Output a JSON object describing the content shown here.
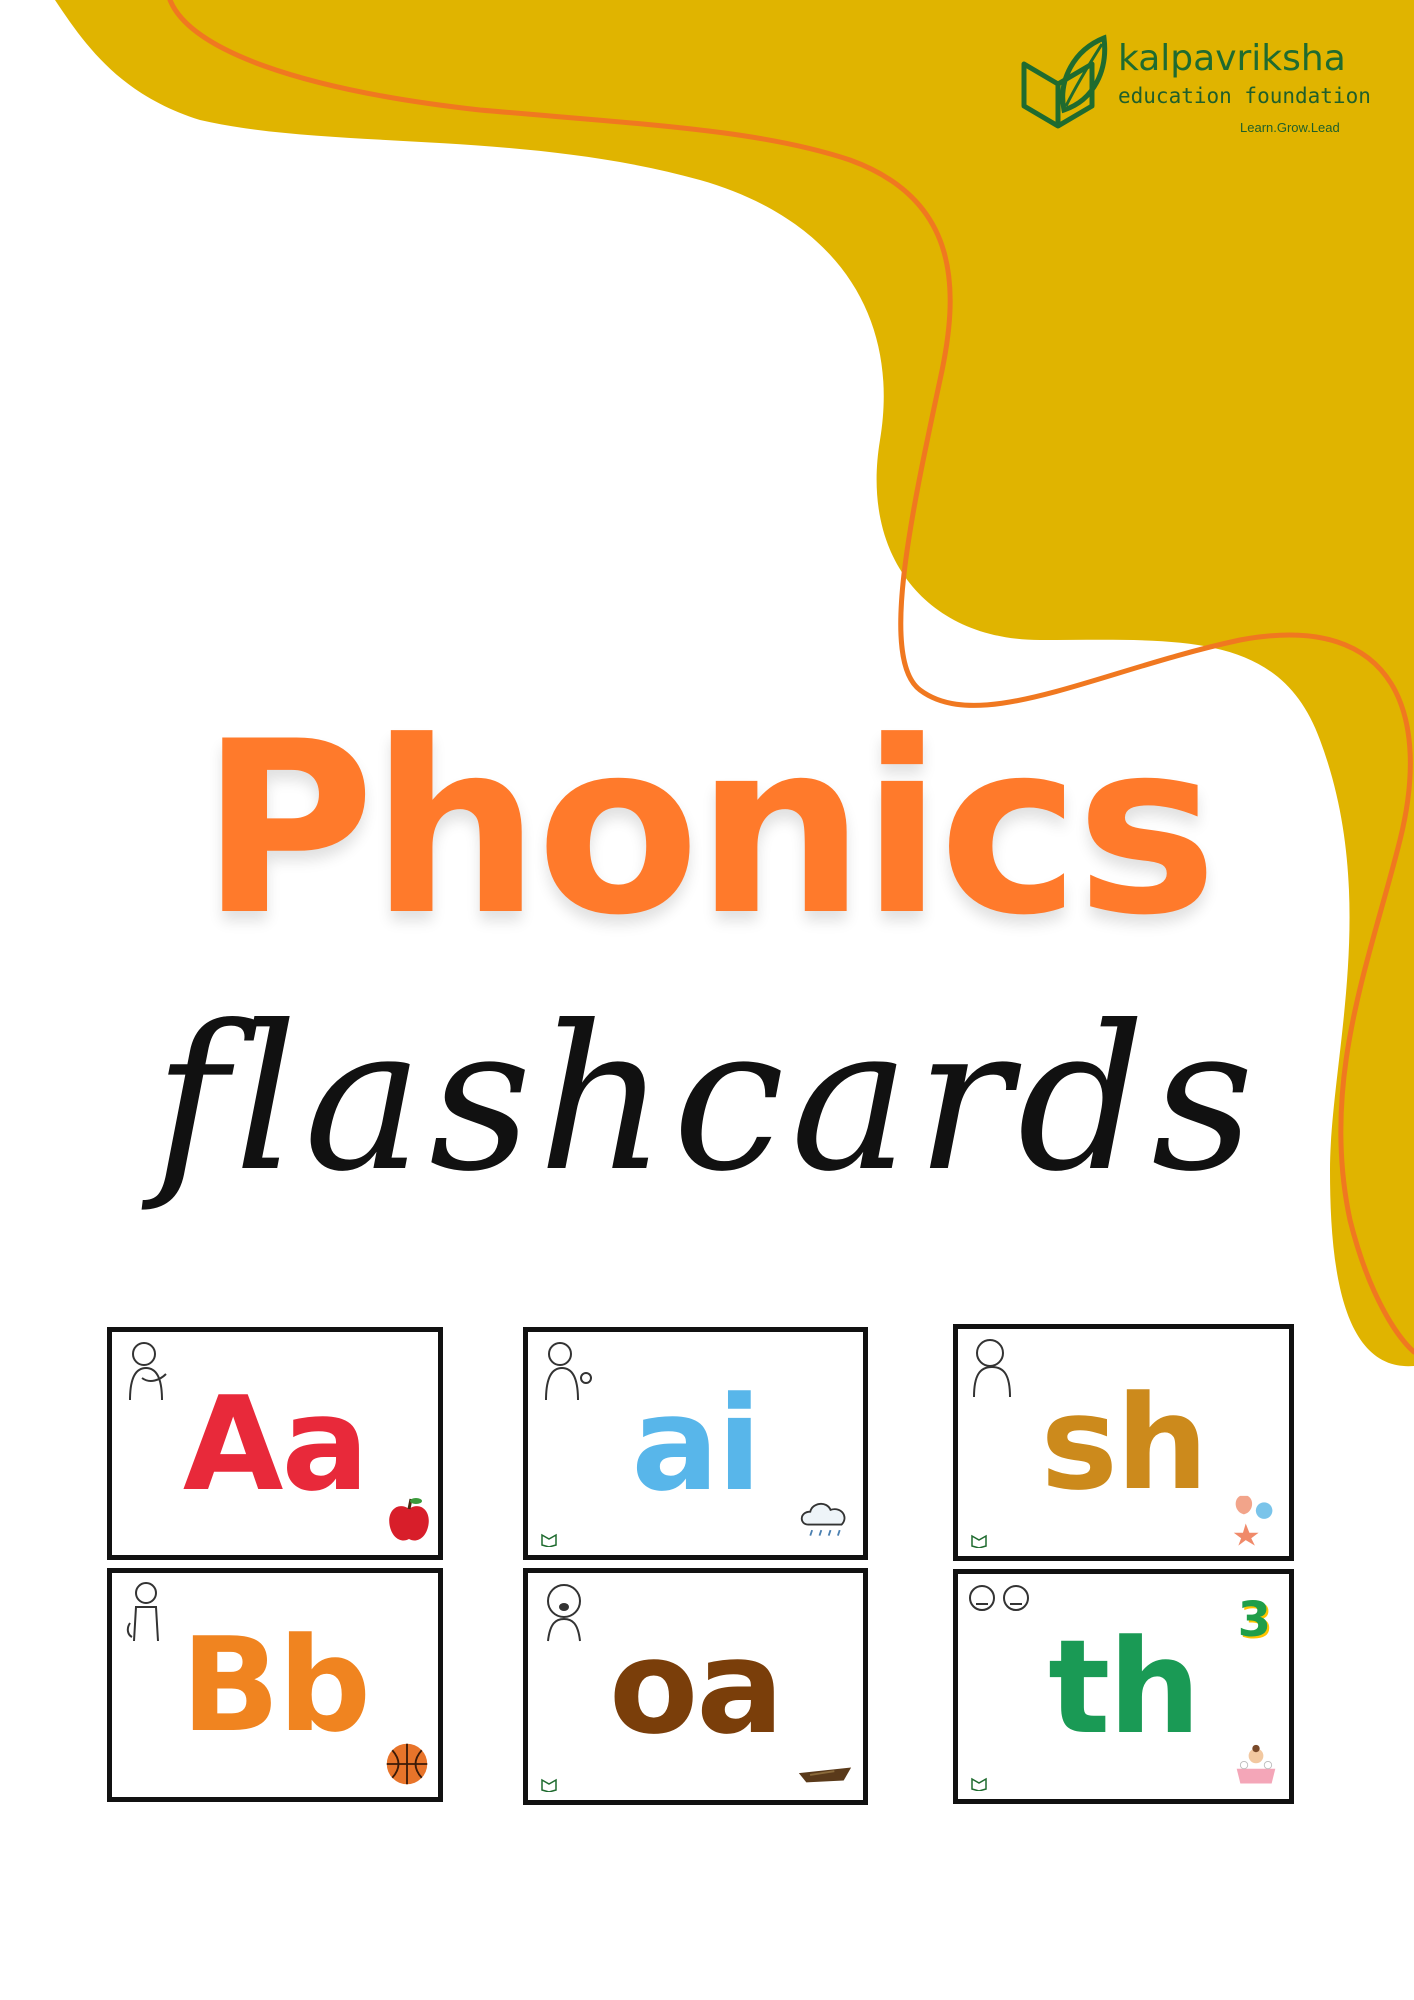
{
  "logo": {
    "name": "kalpavriksha",
    "subtitle": "education foundation",
    "tagline": "Learn.Grow.Lead"
  },
  "title": "Phonics",
  "subtitle": "flashcards",
  "colors": {
    "wave": "#e0b400",
    "wave_line": "#f07820",
    "title": "#ff7a2b",
    "logo_green": "#1f6b2f"
  },
  "cards": [
    {
      "letters": "Aa",
      "color": "#e8293a",
      "picture": "apple-icon",
      "figure": "child-figure"
    },
    {
      "letters": "ai",
      "color": "#58b6ea",
      "picture": "rain-cloud-icon",
      "figure": "child-figure"
    },
    {
      "letters": "sh",
      "color": "#cc8a1c",
      "picture": "seashell-icon",
      "figure": "child-figure"
    },
    {
      "letters": "Bb",
      "color": "#f08420",
      "picture": "basketball-icon",
      "figure": "child-figure"
    },
    {
      "letters": "oa",
      "color": "#7a3e0a",
      "picture": "boat-icon",
      "figure": "child-figure"
    },
    {
      "letters": "th",
      "color": "#1a9a55",
      "picture": "bath-icon",
      "figure": "faces-figure",
      "number": "3"
    }
  ]
}
